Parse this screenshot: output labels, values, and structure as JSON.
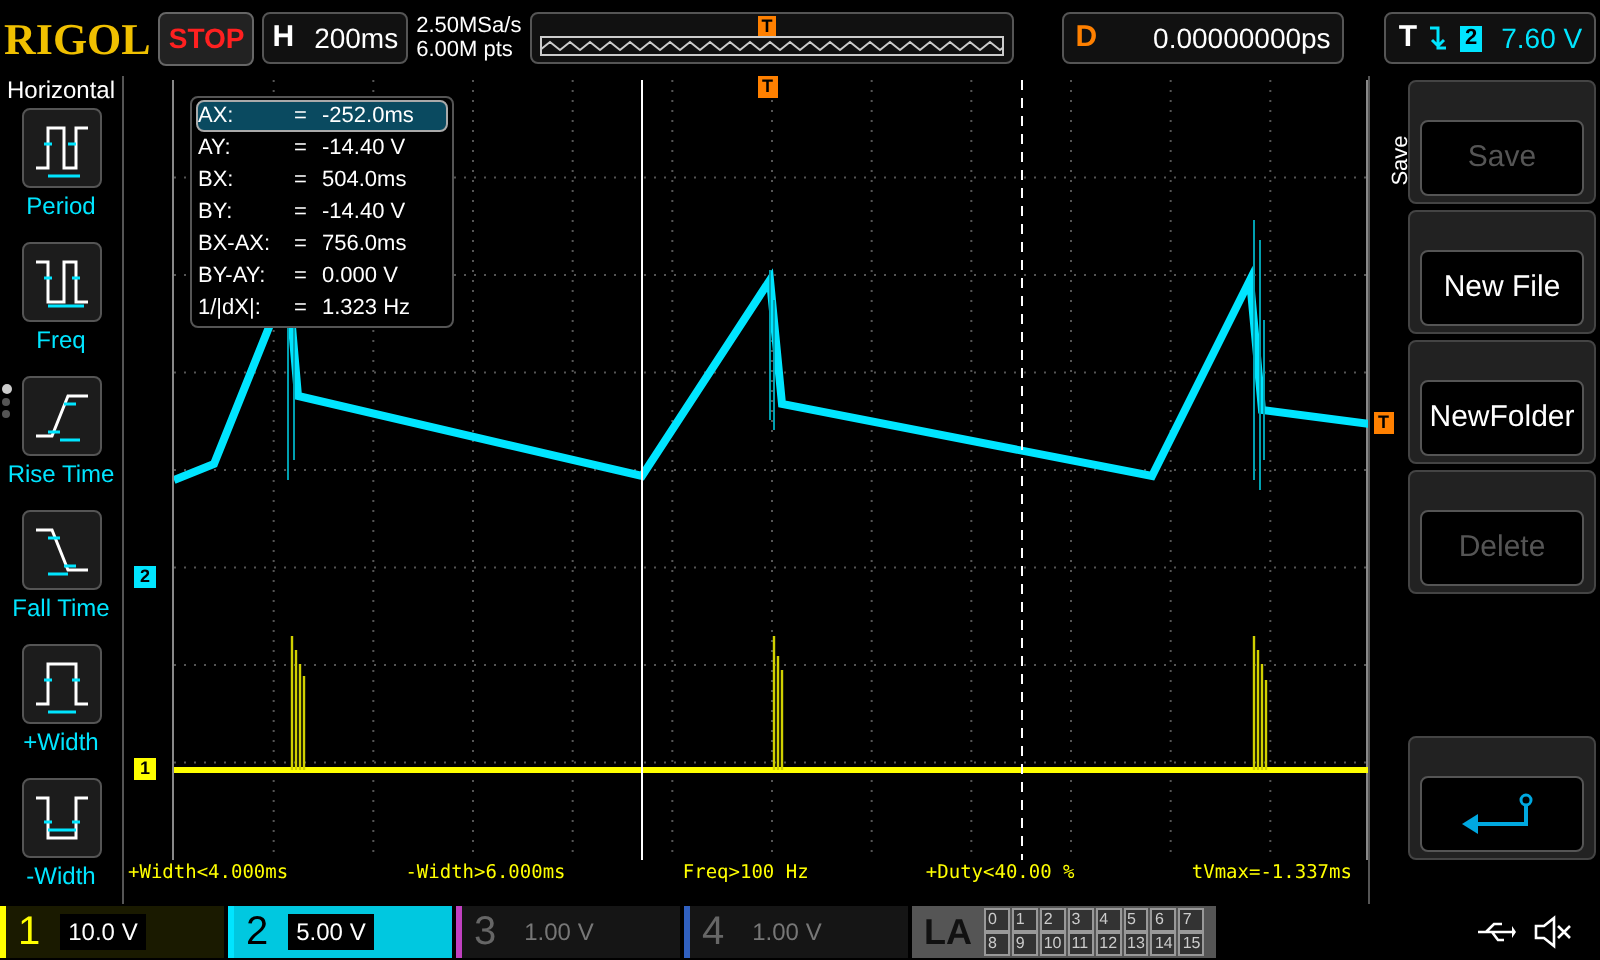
{
  "header": {
    "brand": "RIGOL",
    "run_state": "STOP",
    "horizontal": {
      "label": "H",
      "timebase": "200ms"
    },
    "sample_rate": "2.50MSa/s",
    "memory_depth": "6.00M pts",
    "overview_trigger": "T",
    "delay": {
      "label": "D",
      "value": "0.00000000ps"
    },
    "trigger": {
      "label": "T",
      "source": "2",
      "level": "7.60 V"
    }
  },
  "left_panel": {
    "title": "Horizontal",
    "pages": [
      {
        "selected": true
      },
      {
        "selected": false
      },
      {
        "selected": false
      }
    ],
    "items": [
      {
        "kind": "period",
        "label": "Period"
      },
      {
        "kind": "freq",
        "label": "Freq"
      },
      {
        "kind": "rise",
        "label": "Rise Time"
      },
      {
        "kind": "fall",
        "label": "Fall Time"
      },
      {
        "kind": "pwidth",
        "label": "+Width"
      },
      {
        "kind": "nwidth",
        "label": "-Width"
      }
    ]
  },
  "cursor_readout": [
    {
      "label": "AX:",
      "eq": "=",
      "value": "-252.0ms",
      "selected": true
    },
    {
      "label": "AY:",
      "eq": "=",
      "value": "-14.40 V",
      "selected": false
    },
    {
      "label": "BX:",
      "eq": "=",
      "value": "504.0ms",
      "selected": false
    },
    {
      "label": "BY:",
      "eq": "=",
      "value": "-14.40 V",
      "selected": false
    },
    {
      "label": "BX-AX:",
      "eq": "=",
      "value": "756.0ms",
      "selected": false
    },
    {
      "label": "BY-AY:",
      "eq": "=",
      "value": "0.000 V",
      "selected": false
    },
    {
      "label": "1/|dX|:",
      "eq": "=",
      "value": "1.323 Hz",
      "selected": false
    }
  ],
  "markers": {
    "trigger_top": "T",
    "trigger_level": "T",
    "channel_2": "2",
    "channel_1": "1"
  },
  "measurements": [
    "+Width<4.000ms",
    "-Width>6.000ms",
    "Freq>100 Hz",
    "+Duty<40.00 %",
    "tVmax=-1.337ms"
  ],
  "right_menu": {
    "title": "Save",
    "items": [
      {
        "kind": "text",
        "label": "Save",
        "disabled": true
      },
      {
        "kind": "text",
        "label": "New File",
        "disabled": false
      },
      {
        "kind": "text",
        "label": "NewFolder",
        "disabled": false
      },
      {
        "kind": "text",
        "label": "Delete",
        "disabled": true
      },
      {
        "kind": "back",
        "disabled": false
      }
    ]
  },
  "channels": [
    {
      "number": "1",
      "scale": "10.0 V",
      "enabled": true,
      "color": "#ffff00"
    },
    {
      "number": "2",
      "scale": "5.00 V",
      "enabled": true,
      "color": "#00e5ff"
    },
    {
      "number": "3",
      "scale": "1.00 V",
      "enabled": false,
      "color": "#c040c0"
    },
    {
      "number": "4",
      "scale": "1.00 V",
      "enabled": false,
      "color": "#3060c0"
    }
  ],
  "logic": {
    "label": "LA",
    "bits": [
      "0",
      "1",
      "2",
      "3",
      "4",
      "5",
      "6",
      "7",
      "8",
      "9",
      "10",
      "11",
      "12",
      "13",
      "14",
      "15"
    ]
  }
}
